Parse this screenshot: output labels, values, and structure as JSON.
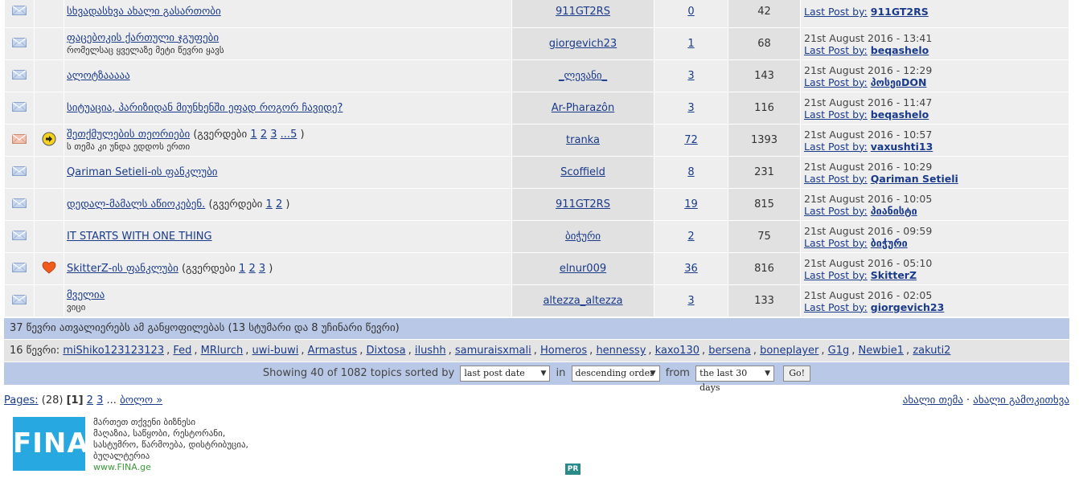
{
  "colors": {
    "link": "#1a3a8a",
    "row_bg": "#eeeeee",
    "row_bg_alt": "#e1e1e1",
    "stats_bar": "#b9c8e6",
    "ad_logo": "#27a8e0"
  },
  "icons": {
    "envelope": "envelope-icon",
    "arrow": "arrow-right-icon",
    "heart": "heart-icon"
  },
  "topics": [
    {
      "title": "სხვადასხვა ახალი გასართობი",
      "subtitle": "",
      "pages": [],
      "author": "911GT2RS",
      "replies": "0",
      "views": "42",
      "last_date": "",
      "last_label": "Last Post by:",
      "last_user": "911GT2RS",
      "icon": "",
      "env_color": "blue"
    },
    {
      "title": "ფაცებოკის ქართული ჯგუფები",
      "subtitle": "რომელსაც ყველაზე მეტი წევრი ყავს",
      "pages": [],
      "author": "giorgevich23",
      "replies": "1",
      "views": "68",
      "last_date": "21st August 2016 - 13:41",
      "last_label": "Last Post by:",
      "last_user": "beqashelo",
      "icon": "",
      "env_color": "blue"
    },
    {
      "title": "ალოტზააააა",
      "subtitle": "",
      "pages": [],
      "author": "_ლევანი_",
      "replies": "3",
      "views": "143",
      "last_date": "21st August 2016 - 12:29",
      "last_label": "Last Post by:",
      "last_user": "პოსეიDON",
      "icon": "",
      "env_color": "blue"
    },
    {
      "title": "სიტუაცია, პარიზიდან მიუნხენში ეფად როგორ ჩავიდე?",
      "subtitle": "",
      "pages": [],
      "author": "Ar-Pharazôn",
      "replies": "3",
      "views": "116",
      "last_date": "21st August 2016 - 11:47",
      "last_label": "Last Post by:",
      "last_user": "beqashelo",
      "icon": "",
      "env_color": "blue"
    },
    {
      "title": "შეთქმულების თეორიები",
      "subtitle": "ს თემა კი უნდა ედდოს ერთი",
      "pages_prefix": "(გვერდები",
      "pages": [
        "1",
        "2",
        "3",
        "...5"
      ],
      "pages_suffix": ")",
      "author": "tranka",
      "replies": "72",
      "views": "1393",
      "last_date": "21st August 2016 - 10:57",
      "last_label": "Last Post by:",
      "last_user": "vaxushti13",
      "icon": "arrow",
      "env_color": "orange"
    },
    {
      "title": "Qariman Setieli-ის ფანკლუბი",
      "subtitle": "",
      "pages": [],
      "author": "Scoffield",
      "replies": "8",
      "views": "231",
      "last_date": "21st August 2016 - 10:29",
      "last_label": "Last Post by:",
      "last_user": "Qariman Setieli",
      "icon": "",
      "env_color": "blue"
    },
    {
      "title": "დედალ-მამალს აწიოკებენ.",
      "subtitle": "",
      "pages_prefix": "(გვერდები",
      "pages": [
        "1",
        "2"
      ],
      "pages_suffix": ")",
      "author": "911GT2RS",
      "replies": "19",
      "views": "815",
      "last_date": "21st August 2016 - 10:05",
      "last_label": "Last Post by:",
      "last_user": "პიანისტი",
      "icon": "",
      "env_color": "blue"
    },
    {
      "title": "IT STARTS WITH ONE THING",
      "subtitle": "",
      "pages": [],
      "author": "ბიჭური",
      "replies": "2",
      "views": "75",
      "last_date": "21st August 2016 - 09:59",
      "last_label": "Last Post by:",
      "last_user": "ბიჭური",
      "icon": "",
      "env_color": "blue"
    },
    {
      "title": "SkitterZ-ის ფანკლუბი",
      "subtitle": "",
      "pages_prefix": "(გვერდები",
      "pages": [
        "1",
        "2",
        "3"
      ],
      "pages_suffix": ")",
      "author": "elnur009",
      "replies": "36",
      "views": "816",
      "last_date": "21st August 2016 - 05:10",
      "last_label": "Last Post by:",
      "last_user": "SkitterZ",
      "icon": "heart",
      "env_color": "blue"
    },
    {
      "title": "მველია",
      "subtitle": "ვიცი",
      "pages": [],
      "author": "altezza_altezza",
      "replies": "3",
      "views": "133",
      "last_date": "21st August 2016 - 02:05",
      "last_label": "Last Post by:",
      "last_user": "giorgevich23",
      "icon": "",
      "env_color": "blue"
    }
  ],
  "stats": {
    "readers": "37 წევრი ათვალიერებს ამ განყოფილებას (13 სტუმარი და 8 უჩინარი წევრი)",
    "members_label": "16 წევრი:",
    "members": [
      "miShiko123123123",
      "Fed",
      "MRlurch",
      "uwi-buwi",
      "Armastus",
      "Dixtosa",
      "ilushh",
      "samuraisxmali",
      "Homeros",
      "hennessy",
      "kaxo130",
      "bersena",
      "boneplayer",
      "G1g",
      "Newbie1",
      "zakuti2"
    ]
  },
  "sort": {
    "showing": "Showing 40 of 1082 topics sorted by",
    "sort_by": "last post date",
    "in": "in",
    "order": "descending order",
    "from": "from",
    "range": "the last 30 days",
    "go": "Go!"
  },
  "pagination": {
    "label": "Pages:",
    "total": "(28)",
    "current": "[1]",
    "pages": [
      "2",
      "3"
    ],
    "ellipsis": "...",
    "last": "ბოლო »",
    "new_topic": "ახალი თემა",
    "separator": "·",
    "new_poll": "ახალი გამოკითხვა"
  },
  "ad": {
    "logo": "FINA",
    "lines": [
      "მართეთ თქვენი ბიზნესი",
      "მაღაზია, საწყობი, რესტორანი,",
      "სასტუმრო, წარმოება, დისტრიბუცია,",
      "ბუღალტერია"
    ],
    "url": "www.FINA.ge",
    "badge": "PR"
  }
}
